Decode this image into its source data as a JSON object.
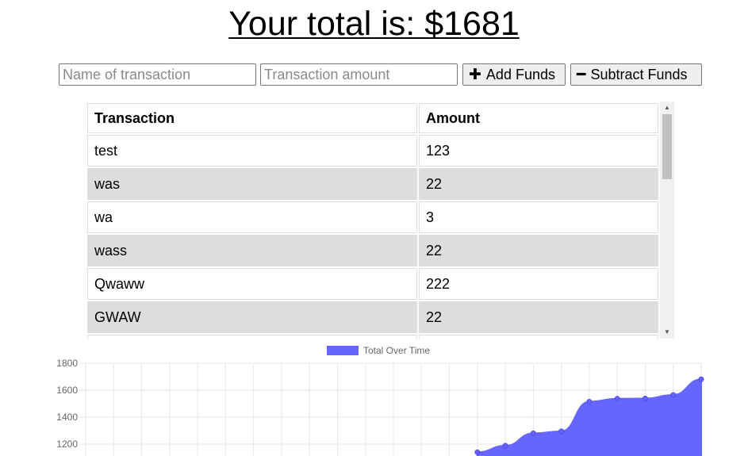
{
  "header": {
    "total_text": "Your total is: $1681"
  },
  "form": {
    "name_placeholder": "Name of transaction",
    "amount_placeholder": "Transaction amount",
    "add_label": "Add Funds",
    "subtract_label": "Subtract Funds",
    "add_icon": "plus-icon",
    "subtract_icon": "minus-icon"
  },
  "table": {
    "headers": [
      "Transaction",
      "Amount"
    ],
    "rows": [
      [
        "test",
        "123"
      ],
      [
        "was",
        "22"
      ],
      [
        "wa",
        "3"
      ],
      [
        "wass",
        "22"
      ],
      [
        "Qwaww",
        "222"
      ],
      [
        "GWAW",
        "22"
      ]
    ]
  },
  "colors": {
    "series": "#6666ff",
    "grid": "#e6e6e6",
    "row_shade": "#dddddd"
  },
  "chart_data": {
    "type": "area",
    "title": "",
    "legend": {
      "position": "top",
      "label": "Total Over Time"
    },
    "series": [
      {
        "name": "Total Over Time",
        "values": [
          null,
          null,
          null,
          null,
          null,
          null,
          null,
          null,
          null,
          null,
          null,
          null,
          null,
          null,
          1140,
          1188,
          1280,
          1295,
          1515,
          1537,
          1538,
          1565,
          1681
        ]
      }
    ],
    "ylim": [
      1100,
      1800
    ],
    "yticks": [
      1200,
      1400,
      1600,
      1800
    ],
    "grid": true
  }
}
